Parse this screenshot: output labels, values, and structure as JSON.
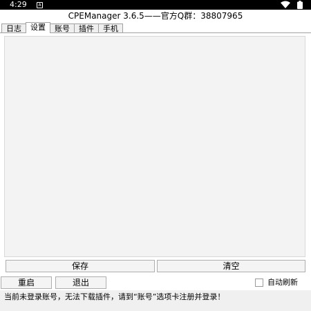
{
  "status_bar": {
    "time": "4:29",
    "notification_glyph": "A",
    "icons": [
      "notification-icon",
      "wifi-icon",
      "battery-icon"
    ]
  },
  "window": {
    "title": "CPEManager 3.6.5——官方Q群：38807965"
  },
  "tabs": [
    {
      "label": "日志",
      "active": false
    },
    {
      "label": "设置",
      "active": true
    },
    {
      "label": "账号",
      "active": false
    },
    {
      "label": "插件",
      "active": false
    },
    {
      "label": "手机",
      "active": false
    }
  ],
  "settings": {
    "save_label": "保存",
    "clear_label": "清空"
  },
  "controls": {
    "restart_label": "重启",
    "exit_label": "退出",
    "auto_refresh_label": "自动刷新",
    "auto_refresh_checked": false
  },
  "status": {
    "message": "当前未登录账号，无法下载插件，请到“账号”选项卡注册并登录！"
  },
  "colors": {
    "status_bar_bg": "#000000",
    "panel_bg": "#f3f3f3",
    "button_bg": "#f4f4f4"
  }
}
